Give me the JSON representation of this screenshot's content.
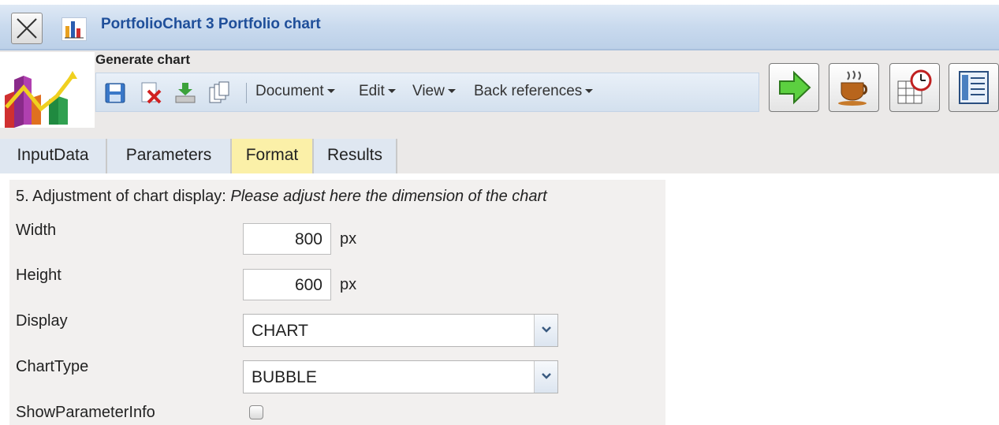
{
  "window": {
    "title": "PortfolioChart 3 Portfolio chart"
  },
  "header": {
    "label": "Generate chart"
  },
  "menu": {
    "document": "Document",
    "edit": "Edit",
    "view": "View",
    "back_references": "Back references"
  },
  "tabs": [
    {
      "label": "InputData"
    },
    {
      "label": "Parameters"
    },
    {
      "label": "Format"
    },
    {
      "label": "Results"
    }
  ],
  "active_tab": "Format",
  "form": {
    "section_title": "5. Adjustment of chart display: ",
    "section_hint": "Please adjust here the dimension of the chart",
    "width": {
      "label": "Width",
      "value": "800",
      "unit": "px"
    },
    "height": {
      "label": "Height",
      "value": "600",
      "unit": "px"
    },
    "display": {
      "label": "Display",
      "value": "CHART"
    },
    "chart_type": {
      "label": "ChartType",
      "value": "BUBBLE"
    },
    "show_parameter_info": {
      "label": "ShowParameterInfo",
      "checked": false
    }
  },
  "colors": {
    "title_text": "#1f4f9a",
    "active_tab": "#fbf0a8",
    "inactive_tab": "#dfe7f1",
    "form_bg": "#f2f0ef"
  },
  "icons": {
    "toolbar": [
      "save-icon",
      "delete-icon",
      "download-icon",
      "copy-icon"
    ],
    "actions": [
      "run-arrow-icon",
      "coffee-cup-icon",
      "calendar-clock-icon",
      "list-icon"
    ]
  }
}
